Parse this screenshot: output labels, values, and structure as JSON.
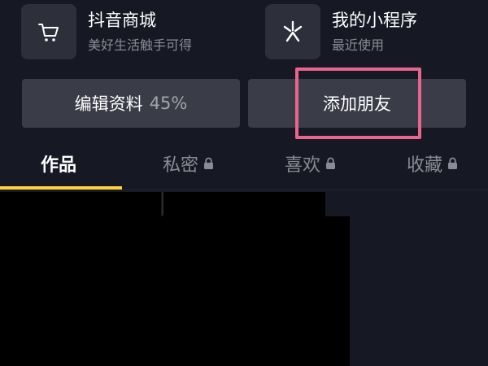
{
  "services": [
    {
      "title": "抖音商城",
      "subtitle": "美好生活触手可得",
      "icon": "shopping-cart-icon"
    },
    {
      "title": "我的小程序",
      "subtitle": "最近使用",
      "icon": "mini-program-icon"
    }
  ],
  "actions": {
    "edit_label": "编辑资料",
    "edit_progress": "45%",
    "add_friend_label": "添加朋友"
  },
  "tabs": [
    {
      "label": "作品",
      "active": true,
      "locked": false
    },
    {
      "label": "私密",
      "active": false,
      "locked": true
    },
    {
      "label": "喜欢",
      "active": false,
      "locked": true
    },
    {
      "label": "收藏",
      "active": false,
      "locked": true
    }
  ],
  "colors": {
    "background": "#161823",
    "button": "#3a3c47",
    "tab_indicator": "#fcd33a",
    "highlight": "#e8668c"
  }
}
